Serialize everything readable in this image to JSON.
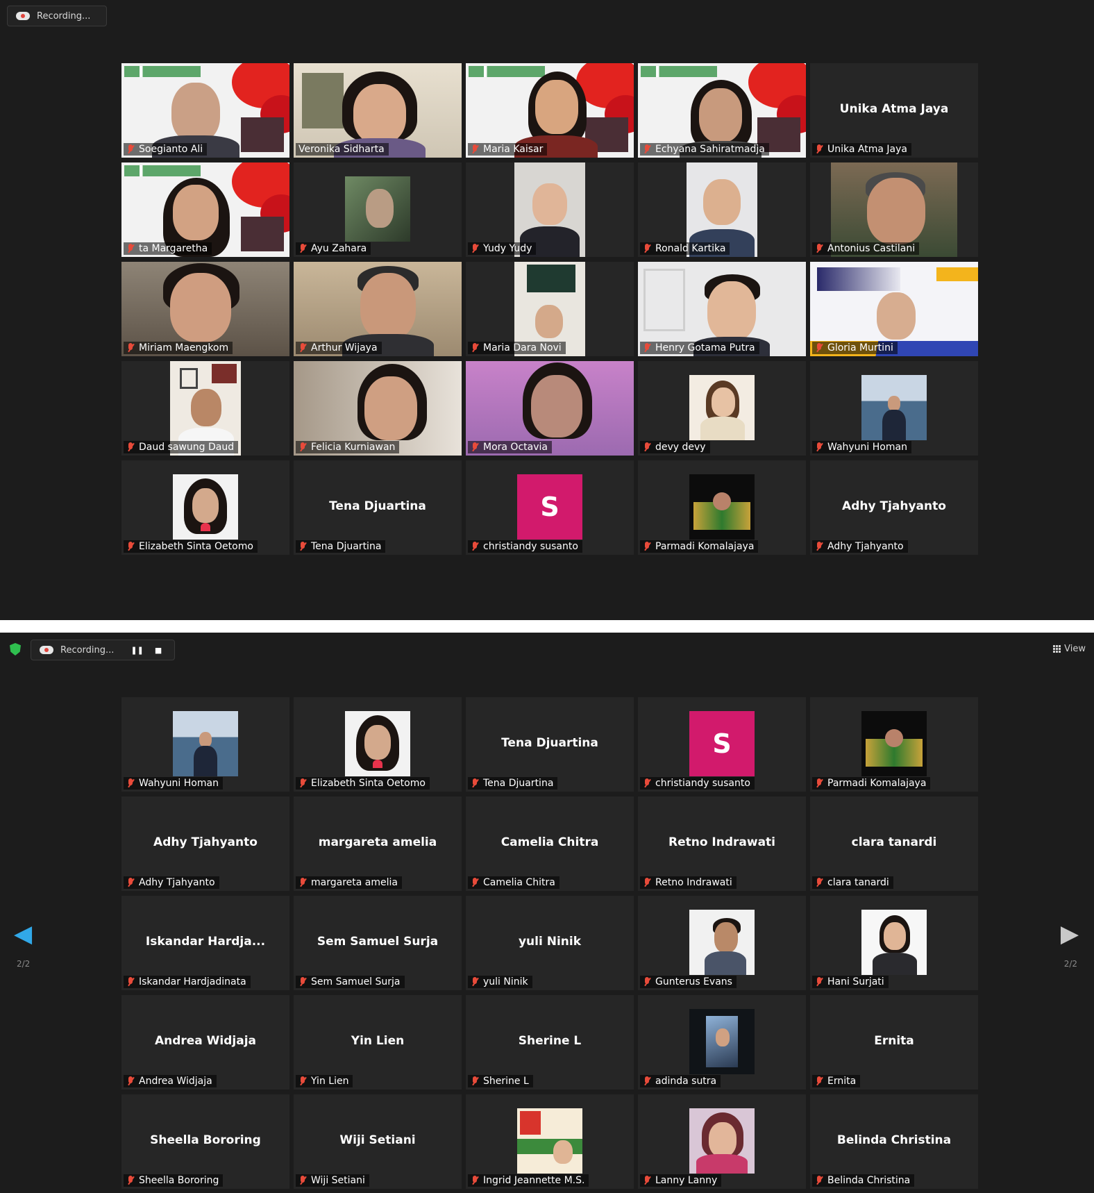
{
  "screen1": {
    "recording_label": "Recording...",
    "tiles": [
      {
        "caption": "Soegianto Ali",
        "big": ""
      },
      {
        "caption": "Veronika Sidharta",
        "big": ""
      },
      {
        "caption": "Maria Kaisar",
        "big": ""
      },
      {
        "caption": "Echyana Sahiratmadja",
        "big": ""
      },
      {
        "caption": "Unika Atma Jaya",
        "big": "Unika Atma Jaya"
      },
      {
        "caption": "ta Margaretha",
        "big": ""
      },
      {
        "caption": "Ayu Zahara",
        "big": ""
      },
      {
        "caption": "Yudy Yudy",
        "big": ""
      },
      {
        "caption": "Ronald Kartika",
        "big": ""
      },
      {
        "caption": "Antonius Castilani",
        "big": ""
      },
      {
        "caption": "Miriam Maengkom",
        "big": ""
      },
      {
        "caption": "Arthur Wijaya",
        "big": ""
      },
      {
        "caption": "Maria Dara Novi",
        "big": ""
      },
      {
        "caption": "Henry Gotama Putra",
        "big": ""
      },
      {
        "caption": "Gloria Murtini",
        "big": ""
      },
      {
        "caption": "Daud sawung Daud",
        "big": ""
      },
      {
        "caption": "Felicia Kurniawan",
        "big": ""
      },
      {
        "caption": "Mora Octavia",
        "big": ""
      },
      {
        "caption": "devy devy",
        "big": ""
      },
      {
        "caption": "Wahyuni Homan",
        "big": ""
      },
      {
        "caption": "Elizabeth Sinta Oetomo",
        "big": ""
      },
      {
        "caption": "Tena Djuartina",
        "big": "Tena Djuartina"
      },
      {
        "caption": "christiandy susanto",
        "big": "",
        "avatar": "S"
      },
      {
        "caption": "Parmadi Komalajaya",
        "big": ""
      },
      {
        "caption": "Adhy Tjahyanto",
        "big": "Adhy Tjahyanto"
      }
    ]
  },
  "screen2": {
    "recording_label": "Recording...",
    "pause_icon": "❚❚",
    "stop_icon": "■",
    "view_label": "View",
    "page_indicator_left": "2/2",
    "page_indicator_right": "2/2",
    "tiles": [
      {
        "caption": "Wahyuni Homan",
        "big": ""
      },
      {
        "caption": "Elizabeth Sinta Oetomo",
        "big": ""
      },
      {
        "caption": "Tena Djuartina",
        "big": "Tena Djuartina"
      },
      {
        "caption": "christiandy susanto",
        "big": "",
        "avatar": "S"
      },
      {
        "caption": "Parmadi Komalajaya",
        "big": ""
      },
      {
        "caption": "Adhy Tjahyanto",
        "big": "Adhy Tjahyanto"
      },
      {
        "caption": "margareta amelia",
        "big": "margareta amelia"
      },
      {
        "caption": "Camelia Chitra",
        "big": "Camelia Chitra"
      },
      {
        "caption": "Retno Indrawati",
        "big": "Retno Indrawati"
      },
      {
        "caption": "clara tanardi",
        "big": "clara tanardi"
      },
      {
        "caption": "Iskandar Hardjadinata",
        "big": "Iskandar Hardja..."
      },
      {
        "caption": "Sem Samuel Surja",
        "big": "Sem Samuel Surja"
      },
      {
        "caption": "yuli Ninik",
        "big": "yuli Ninik"
      },
      {
        "caption": "Gunterus Evans",
        "big": ""
      },
      {
        "caption": "Hani Surjati",
        "big": ""
      },
      {
        "caption": "Andrea Widjaja",
        "big": "Andrea Widjaja"
      },
      {
        "caption": "Yin Lien",
        "big": "Yin Lien"
      },
      {
        "caption": "Sherine L",
        "big": "Sherine L"
      },
      {
        "caption": "adinda sutra",
        "big": ""
      },
      {
        "caption": "Ernita",
        "big": "Ernita"
      },
      {
        "caption": "Sheella Bororing",
        "big": "Sheella Bororing"
      },
      {
        "caption": "Wiji Setiani",
        "big": "Wiji Setiani"
      },
      {
        "caption": "Ingrid Jeannette M.S.",
        "big": ""
      },
      {
        "caption": "Lanny Lanny",
        "big": ""
      },
      {
        "caption": "Belinda Christina",
        "big": "Belinda Christina"
      }
    ]
  }
}
